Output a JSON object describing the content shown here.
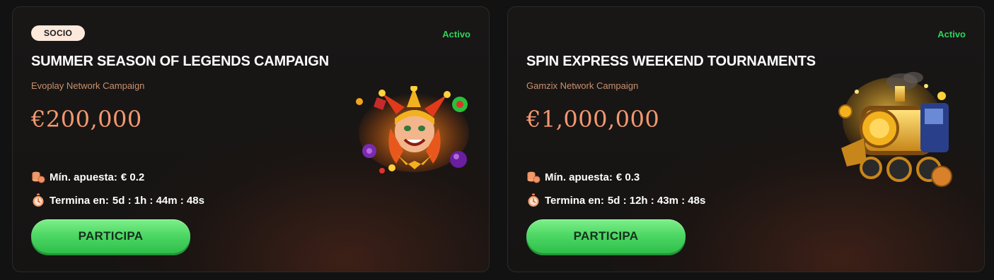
{
  "cards": [
    {
      "badge": "SOCIO",
      "status": "Activo",
      "title": "SUMMER SEASON OF LEGENDS CAMPAIGN",
      "subtitle": "Evoplay Network Campaign",
      "prize": "€200,000",
      "min_bet_label": "Mín. apuesta:",
      "min_bet_value": "€ 0.2",
      "ends_label": "Termina en:",
      "ends_value": "5d : 1h : 44m : 48s",
      "cta": "PARTICIPA",
      "image": "jester-joker-icon"
    },
    {
      "status": "Activo",
      "title": "SPIN EXPRESS WEEKEND TOURNAMENTS",
      "subtitle": "Gamzix Network Campaign",
      "prize": "€1,000,000",
      "min_bet_label": "Mín. apuesta:",
      "min_bet_value": "€ 0.3",
      "ends_label": "Termina en:",
      "ends_value": "5d : 12h : 43m : 48s",
      "cta": "PARTICIPA",
      "image": "golden-train-icon"
    }
  ],
  "icons": {
    "min_bet": "coin-stack-icon",
    "ends": "stopwatch-icon"
  },
  "colors": {
    "accent_prize": "#f49870",
    "status_active": "#2fd35a",
    "cta_green": "#4fd866",
    "badge_bg": "#fde8dc"
  }
}
